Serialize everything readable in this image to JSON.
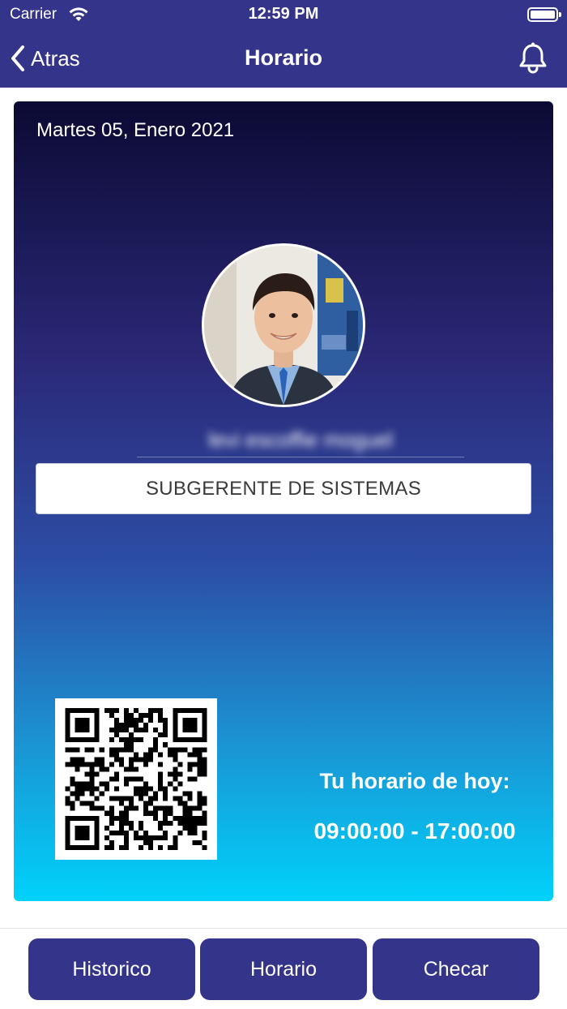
{
  "status_bar": {
    "carrier": "Carrier",
    "time": "12:59 PM"
  },
  "nav": {
    "back_label": "Atras",
    "title": "Horario",
    "icons": {
      "back": "chevron-left-icon",
      "bell": "bell-icon"
    }
  },
  "card": {
    "date": "Martes 05, Enero 2021",
    "employee_name": "levi escoffie moguel",
    "position": "SUBGERENTE DE SISTEMAS",
    "schedule_label": "Tu horario de hoy:",
    "schedule_time": "09:00:00 - 17:00:00"
  },
  "tabs": [
    {
      "label": "Historico"
    },
    {
      "label": "Horario"
    },
    {
      "label": "Checar"
    }
  ],
  "colors": {
    "nav_bg": "#33348a",
    "gradient_top": "#0b0a33",
    "gradient_bottom": "#00d2fb"
  }
}
